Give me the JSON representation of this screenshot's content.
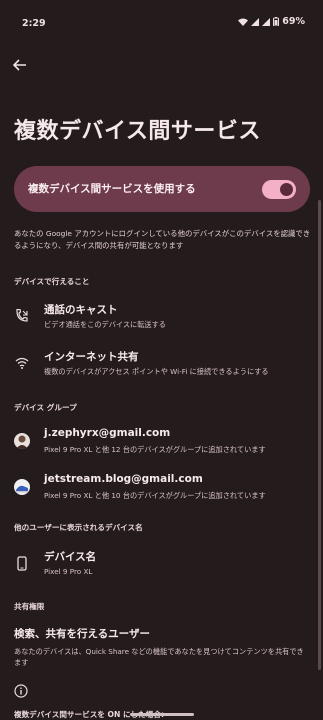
{
  "status_bar": {
    "time": "2:29",
    "battery": "69%"
  },
  "page": {
    "title": "複数デバイス間サービス"
  },
  "master": {
    "label": "複数デバイス間サービスを使用する",
    "enabled": true
  },
  "description": "あなたの Google アカウントにログインしている他のデバイスがこのデバイスを認識できるようになり、デバイス間の共有が可能となります",
  "sections": {
    "capabilities": {
      "title": "デバイスで行えること",
      "items": [
        {
          "title": "通話のキャスト",
          "subtitle": "ビデオ通話をこのデバイスに転送する",
          "icon": "call-cast-icon"
        },
        {
          "title": "インターネット共有",
          "subtitle": "複数のデバイスがアクセス ポイントや Wi-Fi に接続できるようにする",
          "icon": "wifi-icon"
        }
      ]
    },
    "groups": {
      "title": "デバイス グループ",
      "items": [
        {
          "title": "j.zephyrx@gmail.com",
          "subtitle": "Pixel 9 Pro XL と他 12 台のデバイスがグループに追加されています",
          "icon": "avatar-person"
        },
        {
          "title": "jetstream.blog@gmail.com",
          "subtitle": "Pixel 9 Pro XL と他 10 台のデバイスがグループに追加されています",
          "icon": "avatar-shoe"
        }
      ]
    },
    "device_name": {
      "title": "他のユーザーに表示されるデバイス名",
      "item": {
        "title": "デバイス名",
        "subtitle": "Pixel 9 Pro XL",
        "icon": "phone-icon"
      }
    },
    "sharing": {
      "title": "共有権限",
      "item": {
        "title": "検索、共有を行えるユーザー",
        "subtitle": "あなたのデバイスは、Quick Share などの機能であなたを見つけてコンテンツを共有できます"
      }
    }
  },
  "footer_partial": "複数デバイス間サービスを ON にした場合:",
  "colors": {
    "background": "#241b1d",
    "card": "#6e3b4c",
    "toggle_track": "#f3b0c7"
  }
}
